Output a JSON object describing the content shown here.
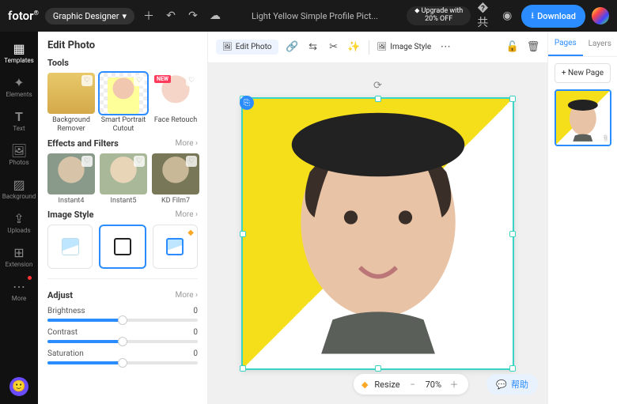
{
  "topbar": {
    "logo": "fotor",
    "role": "Graphic Designer",
    "doc_title": "Light Yellow Simple Profile Pict...",
    "upgrade_l1": "⬥ Upgrade with",
    "upgrade_l2": "20% OFF",
    "download": "Download"
  },
  "sidebar": {
    "items": [
      {
        "label": "Templates"
      },
      {
        "label": "Elements"
      },
      {
        "label": "Text"
      },
      {
        "label": "Photos"
      },
      {
        "label": "Background"
      },
      {
        "label": "Uploads"
      },
      {
        "label": "Extension"
      },
      {
        "label": "More"
      }
    ]
  },
  "panel": {
    "title": "Edit Photo",
    "tools_title": "Tools",
    "tools": [
      {
        "label": "Background Remover"
      },
      {
        "label": "Smart Portrait Cutout"
      },
      {
        "label": "Face Retouch"
      }
    ],
    "fx_title": "Effects and Filters",
    "fx_more": "More ›",
    "fx": [
      {
        "label": "Instant4"
      },
      {
        "label": "Instant5"
      },
      {
        "label": "KD Film7"
      }
    ],
    "style_title": "Image Style",
    "style_more": "More ›",
    "adjust_title": "Adjust",
    "adjust_more": "More ›",
    "adjust": [
      {
        "label": "Brightness",
        "value": "0"
      },
      {
        "label": "Contrast",
        "value": "0"
      },
      {
        "label": "Saturation",
        "value": "0"
      }
    ],
    "new_tag": "NEW"
  },
  "ctx": {
    "edit_photo": "Edit Photo",
    "image_style": "Image Style"
  },
  "zoom": {
    "resize": "Resize",
    "value": "70%"
  },
  "help": "帮助",
  "rail": {
    "tabs": [
      "Pages",
      "Layers"
    ],
    "new_page": "+ New Page",
    "page_num": "1"
  },
  "colors": {
    "accent": "#2a8cff",
    "canvas_yellow": "#f5df1a"
  }
}
